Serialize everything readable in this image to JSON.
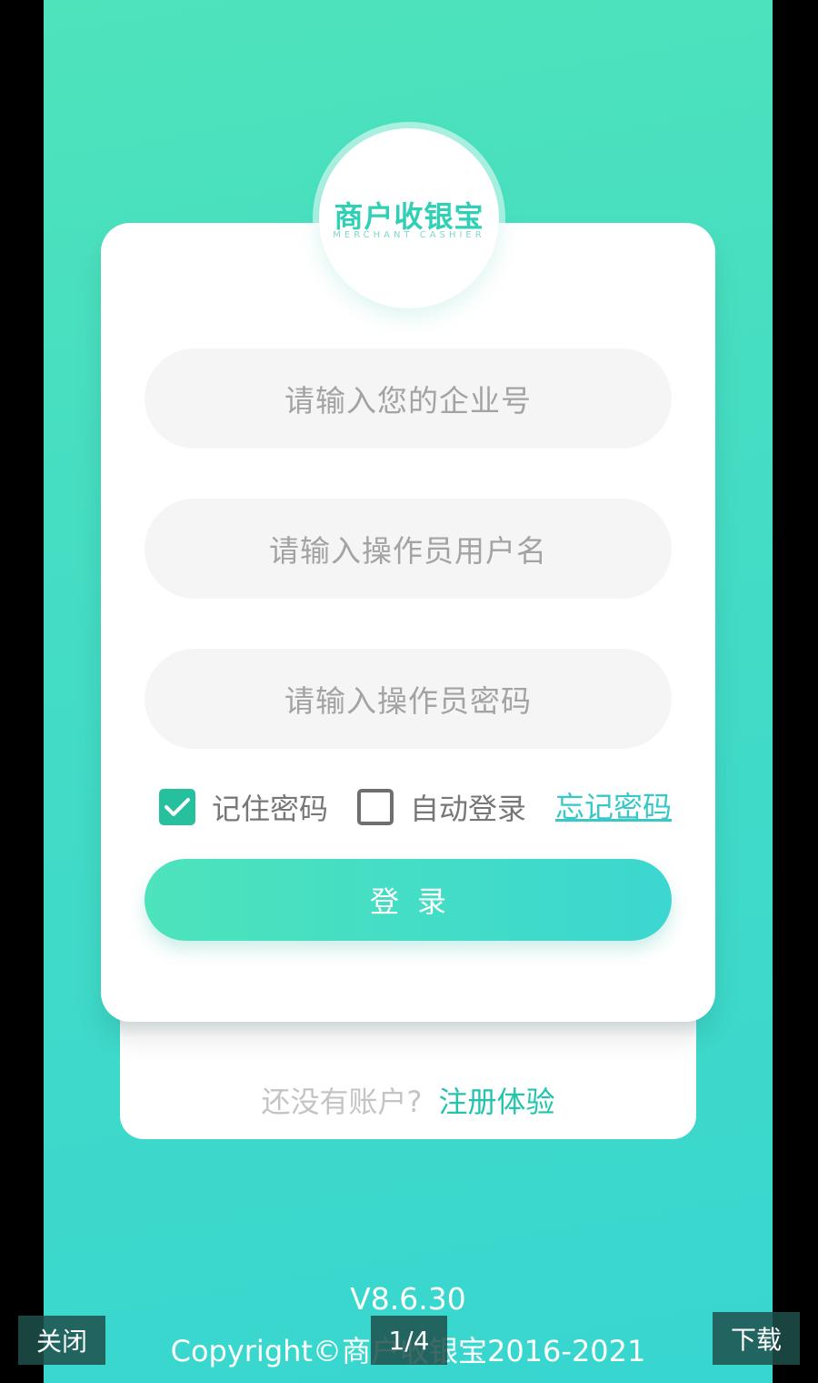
{
  "app": {
    "logo_cn": "商户收银宝",
    "logo_en": "MERCHANT CASHIER"
  },
  "form": {
    "company_placeholder": "请输入您的企业号",
    "username_placeholder": "请输入操作员用户名",
    "password_placeholder": "请输入操作员密码",
    "remember_label": "记住密码",
    "remember_checked": true,
    "auto_login_label": "自动登录",
    "auto_login_checked": false,
    "forgot_label": "忘记密码",
    "login_label": "登录"
  },
  "register": {
    "question": "还没有账户?",
    "link": "注册体验"
  },
  "footer": {
    "version": "V8.6.30",
    "copyright": "Copyright©商户收银宝2016-2021"
  },
  "viewer": {
    "close_label": "关闭",
    "page_indicator": "1/4",
    "download_label": "下载"
  },
  "colors": {
    "accent": "#26c09f",
    "link": "#37c9c7",
    "bg_top": "#4ee3bb",
    "bg_bottom": "#38d6d0"
  }
}
